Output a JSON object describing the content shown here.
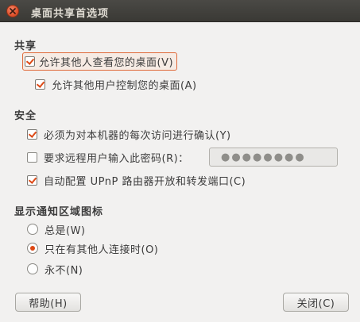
{
  "window": {
    "title": "桌面共享首选项"
  },
  "sharing": {
    "header": "共享",
    "allow_view": {
      "label": "允许其他人查看您的桌面(V)",
      "checked": true
    },
    "allow_control": {
      "label": "允许其他用户控制您的桌面(A)",
      "checked": true
    }
  },
  "security": {
    "header": "安全",
    "confirm_each": {
      "label": "必须为对本机器的每次访问进行确认(Y)",
      "checked": true
    },
    "require_password": {
      "label": "要求远程用户输入此密码(R)：",
      "checked": false
    },
    "password_value": "●●●●●●●●",
    "upnp": {
      "label": "自动配置 UPnP 路由器开放和转发端口(C)",
      "checked": true
    }
  },
  "notification": {
    "header": "显示通知区域图标",
    "options": [
      {
        "label": "总是(W)",
        "selected": false
      },
      {
        "label": "只在有其他人连接时(O)",
        "selected": true
      },
      {
        "label": "永不(N)",
        "selected": false
      }
    ]
  },
  "buttons": {
    "help": "帮助(H)",
    "close": "关闭(C)"
  },
  "colors": {
    "accent": "#dd4814",
    "titlebar": "#3c3b37",
    "background": "#f2f1f0"
  }
}
